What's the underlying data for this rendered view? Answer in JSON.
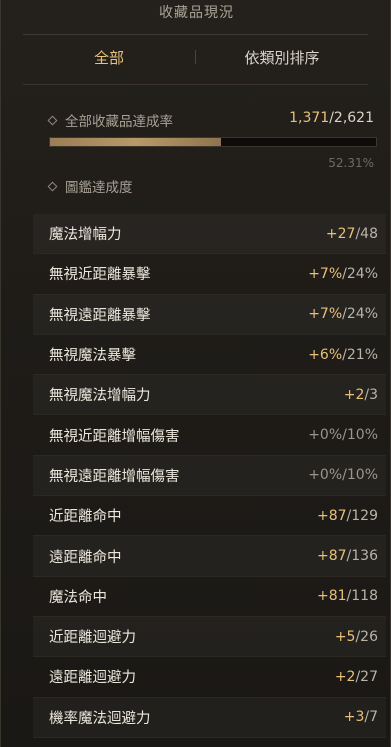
{
  "header": {
    "title": "收藏品現況"
  },
  "tabs": [
    {
      "label": "全部",
      "active": true
    },
    {
      "label": "依類別排序",
      "active": false
    }
  ],
  "collection": {
    "label": "全部收藏品達成率",
    "current": "1,371",
    "separator": "/",
    "max": "2,621",
    "percent_text": "52.31%",
    "progress_fraction": 0.5231
  },
  "codex": {
    "label": "圖鑑達成度"
  },
  "stats": [
    {
      "name": "魔法增幅力",
      "current": "+27",
      "max": "48"
    },
    {
      "name": "無視近距離暴擊",
      "current": "+7%",
      "max": "24%"
    },
    {
      "name": "無視遠距離暴擊",
      "current": "+7%",
      "max": "24%"
    },
    {
      "name": "無視魔法暴擊",
      "current": "+6%",
      "max": "21%"
    },
    {
      "name": "無視魔法增幅力",
      "current": "+2",
      "max": "3"
    },
    {
      "name": "無視近距離增幅傷害",
      "current": "+0%",
      "max": "10%"
    },
    {
      "name": "無視遠距離增幅傷害",
      "current": "+0%",
      "max": "10%"
    },
    {
      "name": "近距離命中",
      "current": "+87",
      "max": "129"
    },
    {
      "name": "遠距離命中",
      "current": "+87",
      "max": "136"
    },
    {
      "name": "魔法命中",
      "current": "+81",
      "max": "118"
    },
    {
      "name": "近距離迴避力",
      "current": "+5",
      "max": "26"
    },
    {
      "name": "遠距離迴避力",
      "current": "+2",
      "max": "27"
    },
    {
      "name": "機率魔法迴避力",
      "current": "+3",
      "max": "7"
    }
  ],
  "colors": {
    "accent": "#e7c27c",
    "background": "#1f1c18"
  }
}
